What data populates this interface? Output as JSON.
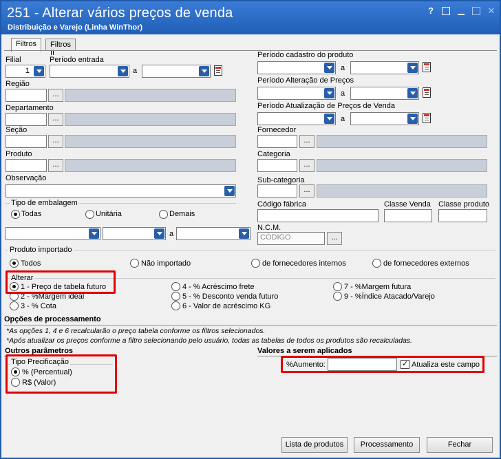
{
  "window": {
    "title": "251 - Alterar vários preços de venda",
    "subtitle": "Distribuição e Varejo (Linha WinThor)",
    "controls": {
      "help": "?"
    }
  },
  "tabs": [
    {
      "label": "Filtros"
    },
    {
      "label": "Filtros II"
    }
  ],
  "left": {
    "filial_label": "Filial",
    "filial_value": "1",
    "periodo_entrada_label": "Período entrada",
    "a_label": "a",
    "regiao_label": "Região",
    "departamento_label": "Departamento",
    "secao_label": "Seção",
    "produto_label": "Produto",
    "observacao_label": "Observação",
    "tipo_embalagem_label": "Tipo de embalagem",
    "emb_todas": "Todas",
    "emb_unitaria": "Unitária",
    "emb_demais": "Demais",
    "range_a": "a"
  },
  "right": {
    "periodo_cadastro_label": "Período cadastro do produto",
    "periodo_alteracao_label": "Período Alteração de Preços",
    "periodo_atualizacao_label": "Período Atualização de Preços de Venda",
    "a_label": "a",
    "fornecedor_label": "Fornecedor",
    "categoria_label": "Categoria",
    "subcategoria_label": "Sub-categoria",
    "codigo_fabrica_label": "Código fábrica",
    "classe_venda_label": "Classe Venda",
    "classe_produto_label": "Classe produto",
    "ncm_label": "N.C.M.",
    "ncm_placeholder": "CÓDIGO"
  },
  "produto_importado": {
    "label": "Produto importado",
    "opt_todos": "Todos",
    "opt_nao_importado": "Não importado",
    "opt_internos": "de fornecedores internos",
    "opt_externos": "de fornecedores externos"
  },
  "alterar": {
    "label": "Alterar",
    "opt1": "1 - Preço de tabela futuro",
    "opt2": "2 - %Margem ideal",
    "opt3": "3 - % Cota",
    "opt4": "4 - % Acréscimo frete",
    "opt5": "5 - % Desconto venda futuro",
    "opt6": "6 - Valor de acréscimo KG",
    "opt7": "7 - %Margem futura",
    "opt9": "9 - %Índice Atacado/Varejo"
  },
  "opcoes_processamento": {
    "label": "Opções de processamento",
    "note1": "*As opções 1, 4 e 6 recalcularão o preço tabela conforme os filtros selecionados.",
    "note2": "*Após atualizar os preços conforme a filtro selecionando pelo usuário, todas as tabelas de todos os produtos são recalculadas."
  },
  "outros_parametros": {
    "label": "Outros parâmetros",
    "tipo_precificacao_label": "Tipo Precificação",
    "opt_percentual": "% (Percentual)",
    "opt_valor": "R$ (Valor)"
  },
  "valores": {
    "label": "Valores a serem aplicados",
    "aumento_label": "%Aumento:",
    "aumento_value": "",
    "atualiza_label": "Atualiza este campo",
    "atualiza_checked": "✓"
  },
  "buttons": {
    "lista_produtos": "Lista de produtos",
    "processamento": "Processamento",
    "fechar": "Fechar"
  },
  "colors": {
    "title_bar": "#1f5fb8",
    "highlight": "#e00000",
    "lookup_field": "#c8cfd8"
  }
}
